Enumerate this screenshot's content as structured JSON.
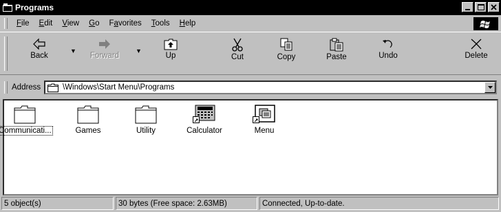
{
  "window": {
    "title": "Programs"
  },
  "menubar": {
    "items": [
      {
        "key": "F",
        "rest": "ile"
      },
      {
        "key": "E",
        "rest": "dit"
      },
      {
        "key": "V",
        "rest": "iew"
      },
      {
        "key": "G",
        "rest": "o"
      },
      {
        "pre": "F",
        "key": "a",
        "rest": "vorites"
      },
      {
        "key": "T",
        "rest": "ools"
      },
      {
        "key": "H",
        "rest": "elp"
      }
    ]
  },
  "toolbar": {
    "back": "Back",
    "forward": "Forward",
    "up": "Up",
    "cut": "Cut",
    "copy": "Copy",
    "paste": "Paste",
    "undo": "Undo",
    "delete": "Delete"
  },
  "address": {
    "label": "Address",
    "value": "\\Windows\\Start Menu\\Programs"
  },
  "items": [
    {
      "name": "Communicati...",
      "icon": "folder-icon",
      "selected": true
    },
    {
      "name": "Games",
      "icon": "folder-icon"
    },
    {
      "name": "Utility",
      "icon": "folder-icon"
    },
    {
      "name": "Calculator",
      "icon": "calculator-shortcut-icon"
    },
    {
      "name": "Menu",
      "icon": "menu-shortcut-icon"
    }
  ],
  "status": {
    "objects": "5 object(s)",
    "space": "30 bytes (Free space: 2.63MB)",
    "connection": "Connected, Up-to-date."
  }
}
